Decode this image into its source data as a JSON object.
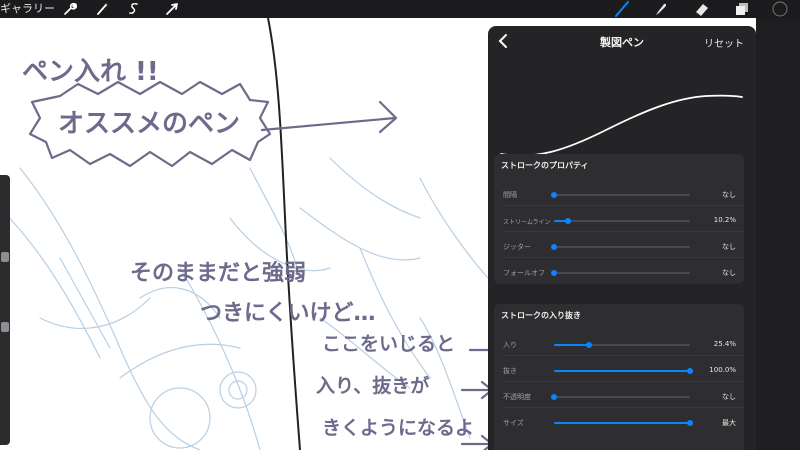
{
  "toolbar": {
    "gallery_label": "ギャラリー",
    "left_tools": [
      "wrench-icon",
      "magic-wand-icon",
      "selection-s-icon",
      "transform-arrow-icon"
    ],
    "right_tools": [
      "brush-icon",
      "smudge-icon",
      "eraser-icon",
      "layers-icon",
      "color-swatch"
    ],
    "accent": "#0a84ff"
  },
  "panel": {
    "title": "製図ペン",
    "back": "‹",
    "reset": "リセット",
    "sections": [
      {
        "title": "ストロークのプロパティ",
        "rows": [
          {
            "label": "間隔",
            "value": "なし",
            "level": 0.0
          },
          {
            "label": "ストリームライン",
            "value": "10.2%",
            "level": 0.102
          },
          {
            "label": "ジッター",
            "value": "なし",
            "level": 0.0
          },
          {
            "label": "フォールオフ",
            "value": "なし",
            "level": 0.0
          }
        ]
      },
      {
        "title": "ストロークの入り抜き",
        "rows": [
          {
            "label": "入り",
            "value": "25.4%",
            "level": 0.254
          },
          {
            "label": "抜き",
            "value": "100.0%",
            "level": 1.0
          },
          {
            "label": "不透明度",
            "value": "なし",
            "level": 0.0
          },
          {
            "label": "サイズ",
            "value": "最大",
            "level": 1.0
          }
        ]
      }
    ]
  },
  "annotations": {
    "line1": "ペン入れ !!",
    "box_text": "オススメのペン",
    "line3": "そのままだと強弱",
    "line4": "つきにくいけど…",
    "line5": "ここをいじると",
    "line6": "入り、抜きが",
    "line7": "きくようになるよ",
    "ink_color": "#6e6a8c"
  }
}
